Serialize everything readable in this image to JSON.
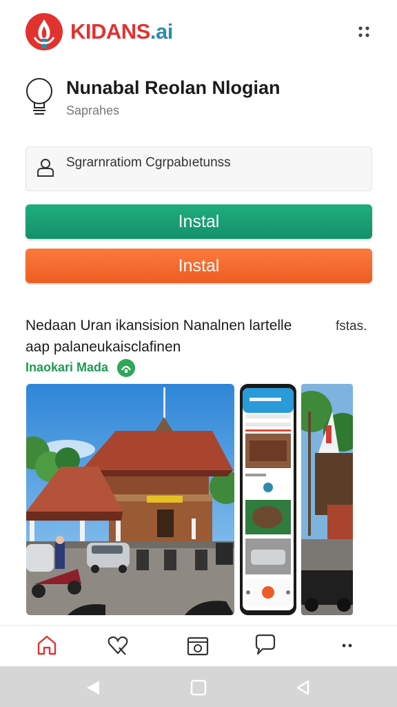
{
  "header": {
    "brand_main": "KIDANS",
    "brand_suffix": ".ai",
    "logo_icon": "flame-logo-icon",
    "menu_icon": "dots-grid-icon",
    "colors": {
      "brand_red": "#e2322f",
      "brand_blue": "#2e8aa8"
    }
  },
  "app": {
    "name": "Nunabal Reolan Nlogian",
    "subtitle": "Saprahes",
    "icon": "lightbulb-icon"
  },
  "info": {
    "text": "Sgrarnratiom Cgrpabıetunss",
    "icon": "person-icon"
  },
  "buttons": {
    "primary_label": "Instal",
    "secondary_label": "Instal",
    "colors": {
      "green": "#17a073",
      "orange": "#f36a2d"
    }
  },
  "description": {
    "line1": "Nedaan Uran ikansision Nanalnen lartelle",
    "line1_right": "fstas.",
    "line2": "aap palaneukaisclafinen",
    "developer": "Inaokari Mada",
    "developer_badge_icon": "check-badge-icon"
  },
  "screenshots": [
    {
      "name": "screenshot-temple"
    },
    {
      "name": "screenshot-phone-app"
    },
    {
      "name": "screenshot-street"
    }
  ],
  "bottom_nav": [
    {
      "name": "nav-home",
      "icon": "home-icon"
    },
    {
      "name": "nav-favorites",
      "icon": "heart-icon"
    },
    {
      "name": "nav-library",
      "icon": "box-icon"
    },
    {
      "name": "nav-chat",
      "icon": "chat-icon"
    },
    {
      "name": "nav-more",
      "icon": "more-icon"
    }
  ],
  "system_nav": [
    "back-icon",
    "home-square-icon",
    "recent-icon"
  ]
}
